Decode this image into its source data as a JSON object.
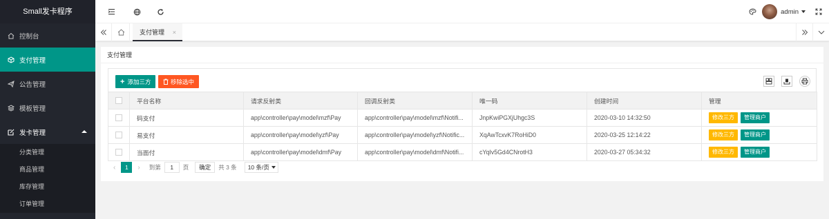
{
  "app": {
    "title": "Small发卡程序"
  },
  "sidebar": {
    "items": [
      {
        "label": "控制台",
        "icon": "home-icon"
      },
      {
        "label": "支付管理",
        "icon": "cube-icon",
        "active": true
      },
      {
        "label": "公告管理",
        "icon": "send-icon"
      },
      {
        "label": "模板管理",
        "icon": "layers-icon"
      },
      {
        "label": "发卡管理",
        "icon": "edit-icon",
        "expanded": true
      }
    ],
    "sub_items": [
      "分类管理",
      "商品管理",
      "库存管理",
      "订单管理"
    ]
  },
  "header": {
    "user": "admin"
  },
  "tabs": [
    {
      "label": "支付管理",
      "close": "×"
    }
  ],
  "panel": {
    "title": "支付管理",
    "add_button": "添加三方",
    "delete_button": "移除选中"
  },
  "table": {
    "columns": [
      "",
      "平台名称",
      "请求反射类",
      "回调反射类",
      "唯一码",
      "创建时间",
      "管理"
    ],
    "rows": [
      {
        "name": "码支付",
        "request": "app\\controller\\pay\\model\\mzf\\Pay",
        "callback": "app\\controller\\pay\\model\\mzf\\Notifi...",
        "code": "JnpKwiPGXjUhgc3S",
        "created": "2020-03-10 14:32:50"
      },
      {
        "name": "易支付",
        "request": "app\\controller\\pay\\model\\yzf\\Pay",
        "callback": "app\\controller\\pay\\model\\yzf\\Notific...",
        "code": "XqAwTcxvK7RoHiD0",
        "created": "2020-03-25 12:14:22"
      },
      {
        "name": "当面付",
        "request": "app\\controller\\pay\\model\\dmf\\Pay",
        "callback": "app\\controller\\pay\\model\\dmf\\Notifi...",
        "code": "cYqIv5Gd4CNrotH3",
        "created": "2020-03-27 05:34:32"
      }
    ],
    "action_edit": "修改三方",
    "action_merchant": "管理商户"
  },
  "pager": {
    "current": "1",
    "goto_label": "到第",
    "goto_value": "1",
    "page_unit": "页",
    "confirm": "确定",
    "total": "共 3 条",
    "page_size": "10 条/页"
  },
  "colors": {
    "accent": "#009688",
    "danger": "#ff5722",
    "warn": "#ffb800",
    "sidebar_bg": "#23262e"
  }
}
